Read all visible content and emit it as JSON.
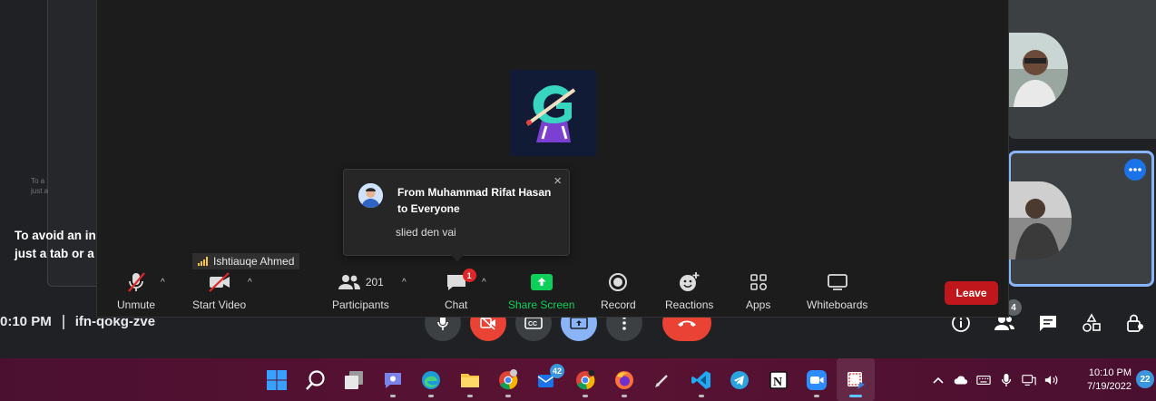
{
  "meet": {
    "tile_text_line1": "To a",
    "tile_text_line2": "just a",
    "tip_line1": "To avoid an in",
    "tip_line2": "just a tab or a",
    "time": "0:10 PM",
    "meeting_code": "ifn-qokg-zve",
    "people_count": "4"
  },
  "zoom": {
    "chat_popup": {
      "from": "From Muhammad Rifat Hasan to Everyone",
      "message": "slied den vai",
      "close": "×"
    },
    "active_speaker": "Ishtiauqe Ahmed",
    "toolbar": {
      "unmute": "Unmute",
      "start_video": "Start Video",
      "participants_label": "Participants",
      "participants_count": "201",
      "chat_label": "Chat",
      "chat_badge": "1",
      "share_screen": "Share Screen",
      "record": "Record",
      "reactions": "Reactions",
      "apps": "Apps",
      "whiteboards": "Whiteboards",
      "leave": "Leave"
    },
    "colors": {
      "share_green": "#0ecf5a",
      "leave_red": "#c0171c",
      "badge_red": "#e02828"
    }
  },
  "taskbar": {
    "apps": [
      {
        "name": "windows-start-icon"
      },
      {
        "name": "search-icon"
      },
      {
        "name": "task-view-icon"
      },
      {
        "name": "teams-chat-icon"
      },
      {
        "name": "edge-icon"
      },
      {
        "name": "file-explorer-icon"
      },
      {
        "name": "chrome-icon"
      },
      {
        "name": "mail-icon",
        "badge": "42"
      },
      {
        "name": "chrome-profile-icon"
      },
      {
        "name": "firefox-icon"
      },
      {
        "name": "pen-icon"
      },
      {
        "name": "vscode-icon"
      },
      {
        "name": "telegram-icon"
      },
      {
        "name": "notion-icon"
      },
      {
        "name": "zoom-icon"
      },
      {
        "name": "snipping-tool-icon"
      }
    ],
    "clock_time": "10:10 PM",
    "clock_date": "7/19/2022",
    "notifications": "22"
  }
}
